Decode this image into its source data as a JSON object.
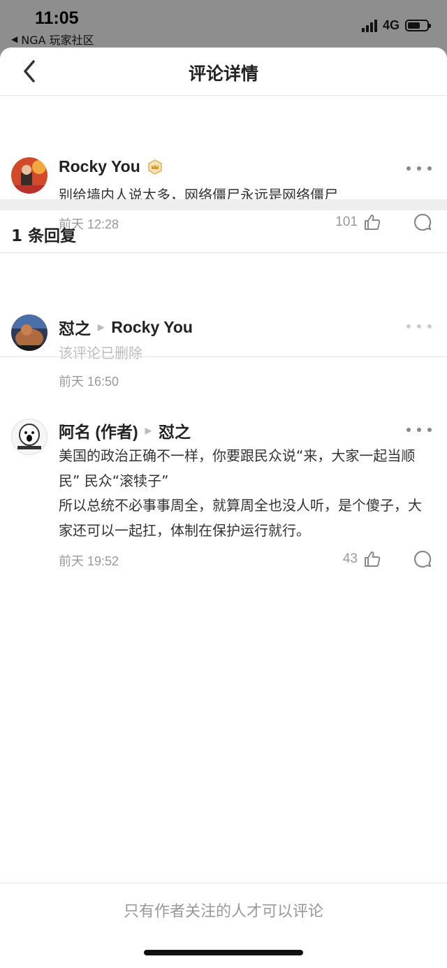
{
  "status_bar": {
    "time": "11:05",
    "back_app": "NGA 玩家社区",
    "network": "4G",
    "battery_level": 0.65
  },
  "nav": {
    "title": "评论详情"
  },
  "main_comment": {
    "author": "Rocky You",
    "text": "别给墙内人说太多，网络僵尸永远是网络僵尸",
    "time": "前天 12:28",
    "likes": "101"
  },
  "replies_header": "1 条回复",
  "replies": [
    {
      "author": "怼之",
      "reply_to": "Rocky You",
      "text": "该评论已删除",
      "time": "前天 16:50"
    },
    {
      "author": "阿名 (作者)",
      "reply_to": "怼之",
      "text": "美国的政治正确不一样，你要跟民众说“来，大家一起当顺民” 民众“滚犊子”",
      "text2": "所以总统不必事事周全，就算周全也没人听，是个傻子，大家还可以一起扛，体制在保护运行就行。",
      "time": "前天 19:52",
      "likes": "43"
    }
  ],
  "footer": {
    "notice": "只有作者关注的人才可以评论"
  },
  "colors": {
    "muted": "#999999",
    "divider": "#e4e4e4",
    "badge": "#e0b060"
  }
}
